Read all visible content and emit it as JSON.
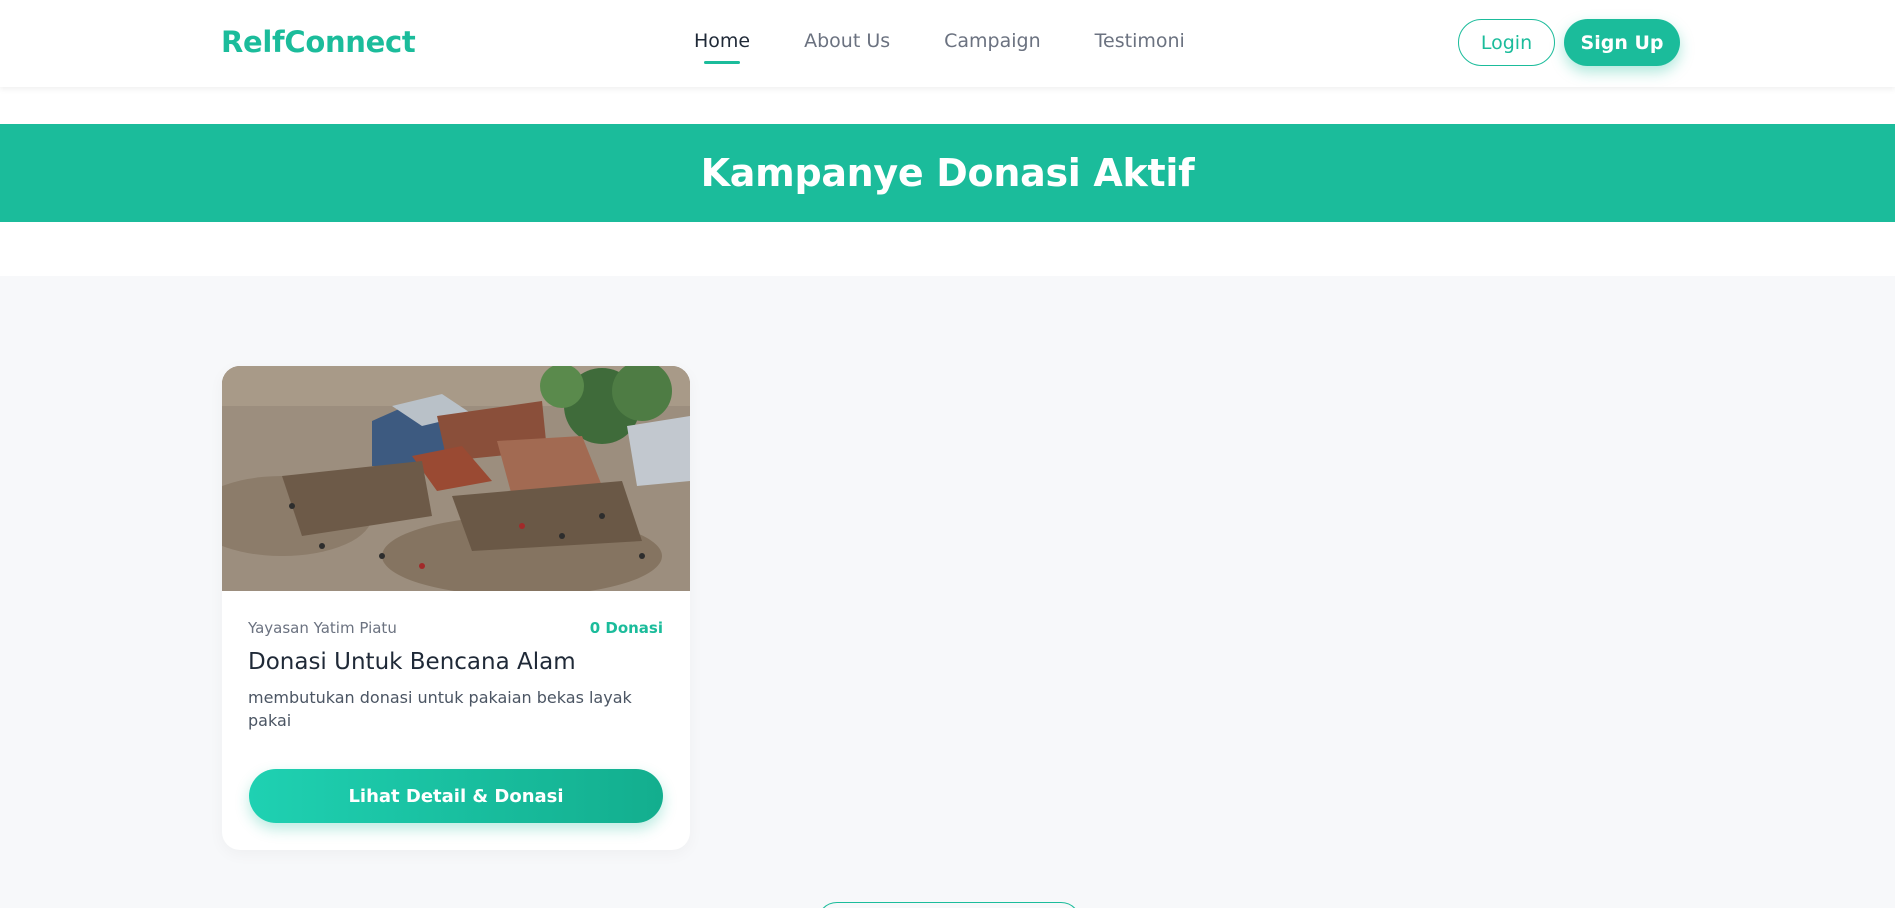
{
  "navbar": {
    "brand": "RelfConnect",
    "links": [
      "Home",
      "About Us",
      "Campaign",
      "Testimoni"
    ],
    "active": "Home",
    "login_label": "Login",
    "signup_label": "Sign Up"
  },
  "hero": {
    "title": "Kampanye Donasi Aktif"
  },
  "campaigns": [
    {
      "organization": "Yayasan Yatim Piatu",
      "donation_count": "0 Donasi",
      "title": "Donasi Untuk Bencana Alam",
      "description": "membutukan donasi untuk pakaian bekas layak pakai",
      "button_label": "Lihat Detail & Donasi",
      "image": "disaster-debris-photo"
    }
  ],
  "colors": {
    "accent": "#1bbc9b",
    "page_bg": "#f7f8fa",
    "text_dark": "#1f2937",
    "text_muted": "#6b7280"
  }
}
